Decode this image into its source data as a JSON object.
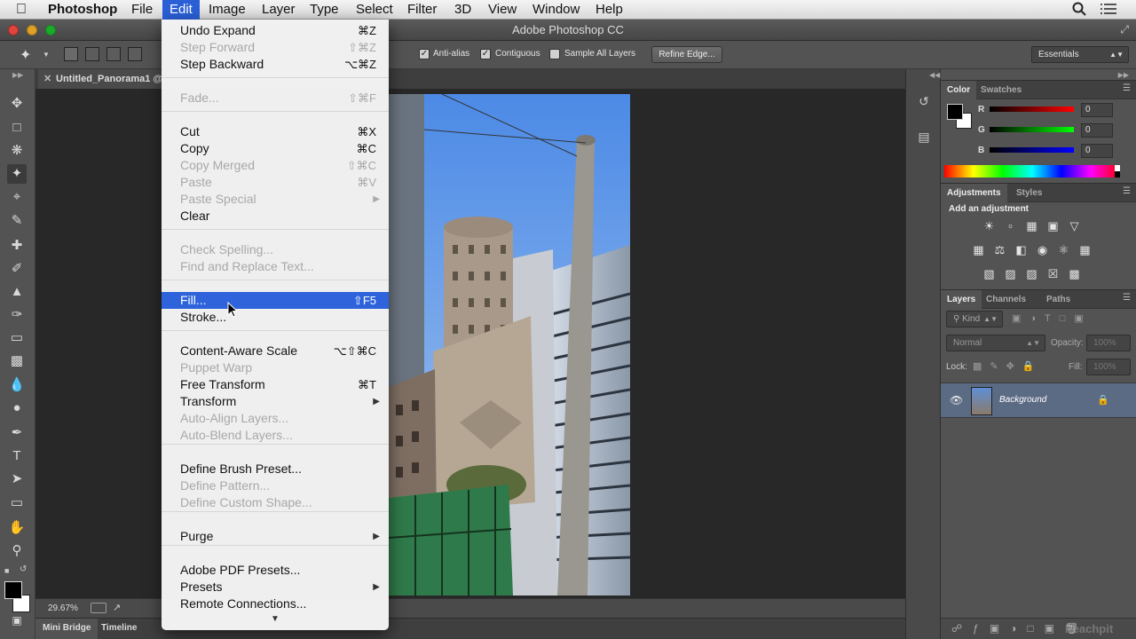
{
  "menubar": {
    "app": "Photoshop",
    "items": [
      "File",
      "Edit",
      "Image",
      "Layer",
      "Type",
      "Select",
      "Filter",
      "3D",
      "View",
      "Window",
      "Help"
    ],
    "active": "Edit",
    "icons": [
      "apple-icon",
      "search-icon",
      "list-icon"
    ]
  },
  "window": {
    "title": "Adobe Photoshop CC"
  },
  "options": {
    "anti_alias": "Anti-alias",
    "contiguous": "Contiguous",
    "sample_all_layers": "Sample All Layers",
    "refine_edge": "Refine Edge...",
    "workspace": "Essentials"
  },
  "document": {
    "tab_title": "Untitled_Panorama1 @",
    "zoom": "29.67%"
  },
  "bottom_tabs": [
    "Mini Bridge",
    "Timeline"
  ],
  "edit_menu": {
    "items": [
      {
        "label": "Undo Expand",
        "shortcut": "⌘Z",
        "enabled": true
      },
      {
        "label": "Step Forward",
        "shortcut": "⇧⌘Z",
        "enabled": false
      },
      {
        "label": "Step Backward",
        "shortcut": "⌥⌘Z",
        "enabled": true
      },
      {
        "label": "Fade...",
        "shortcut": "⇧⌘F",
        "enabled": false
      },
      {
        "label": "Cut",
        "shortcut": "⌘X",
        "enabled": true
      },
      {
        "label": "Copy",
        "shortcut": "⌘C",
        "enabled": true
      },
      {
        "label": "Copy Merged",
        "shortcut": "⇧⌘C",
        "enabled": false
      },
      {
        "label": "Paste",
        "shortcut": "⌘V",
        "enabled": false
      },
      {
        "label": "Paste Special",
        "shortcut": "",
        "enabled": false,
        "submenu": true
      },
      {
        "label": "Clear",
        "shortcut": "",
        "enabled": true
      },
      {
        "label": "Check Spelling...",
        "shortcut": "",
        "enabled": false
      },
      {
        "label": "Find and Replace Text...",
        "shortcut": "",
        "enabled": false
      },
      {
        "label": "Fill...",
        "shortcut": "⇧F5",
        "enabled": true,
        "highlighted": true
      },
      {
        "label": "Stroke...",
        "shortcut": "",
        "enabled": true
      },
      {
        "label": "Content-Aware Scale",
        "shortcut": "⌥⇧⌘C",
        "enabled": true
      },
      {
        "label": "Puppet Warp",
        "shortcut": "",
        "enabled": false
      },
      {
        "label": "Free Transform",
        "shortcut": "⌘T",
        "enabled": true
      },
      {
        "label": "Transform",
        "shortcut": "",
        "enabled": true,
        "submenu": true
      },
      {
        "label": "Auto-Align Layers...",
        "shortcut": "",
        "enabled": false
      },
      {
        "label": "Auto-Blend Layers...",
        "shortcut": "",
        "enabled": false
      },
      {
        "label": "Define Brush Preset...",
        "shortcut": "",
        "enabled": true
      },
      {
        "label": "Define Pattern...",
        "shortcut": "",
        "enabled": false
      },
      {
        "label": "Define Custom Shape...",
        "shortcut": "",
        "enabled": false
      },
      {
        "label": "Purge",
        "shortcut": "",
        "enabled": true,
        "submenu": true
      },
      {
        "label": "Adobe PDF Presets...",
        "shortcut": "",
        "enabled": true
      },
      {
        "label": "Presets",
        "shortcut": "",
        "enabled": true,
        "submenu": true
      },
      {
        "label": "Remote Connections...",
        "shortcut": "",
        "enabled": true
      }
    ]
  },
  "color_panel": {
    "tabs": [
      "Color",
      "Swatches"
    ],
    "r_label": "R",
    "g_label": "G",
    "b_label": "B",
    "r": "0",
    "g": "0",
    "b": "0"
  },
  "adjustments_panel": {
    "tabs": [
      "Adjustments",
      "Styles"
    ],
    "heading": "Add an adjustment"
  },
  "layers_panel": {
    "tabs": [
      "Layers",
      "Channels",
      "Paths"
    ],
    "filter": "Kind",
    "blend_mode": "Normal",
    "opacity_label": "Opacity:",
    "opacity": "100%",
    "lock_label": "Lock:",
    "fill_label": "Fill:",
    "fill": "100%",
    "layer_name": "Background"
  },
  "watermark": "Peachpit"
}
